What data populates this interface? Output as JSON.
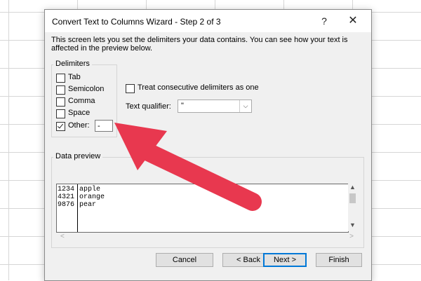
{
  "window": {
    "title": "Convert Text to Columns Wizard - Step 2 of 3",
    "help_label": "?",
    "close_label": "✕"
  },
  "description": "This screen lets you set the delimiters your data contains.  You can see how your text is affected in the preview below.",
  "delimiters": {
    "legend": "Delimiters",
    "items": [
      {
        "label": "Tab",
        "checked": false
      },
      {
        "label": "Semicolon",
        "checked": false
      },
      {
        "label": "Comma",
        "checked": false
      },
      {
        "label": "Space",
        "checked": false
      },
      {
        "label": "Other:",
        "checked": true
      }
    ],
    "other_value": "-"
  },
  "options": {
    "treat_consecutive_label": "Treat consecutive delimiters as one",
    "treat_consecutive_checked": false,
    "text_qualifier_label": "Text qualifier:",
    "text_qualifier_value": "\""
  },
  "preview": {
    "legend": "Data preview",
    "rows": [
      {
        "col1": "1234",
        "col2": "apple"
      },
      {
        "col1": "4321",
        "col2": "orange"
      },
      {
        "col1": "9876",
        "col2": "pear"
      }
    ]
  },
  "buttons": {
    "cancel": "Cancel",
    "back": "< Back",
    "next": "Next >",
    "finish": "Finish"
  },
  "annotation": {
    "arrow_color": "#e8384f"
  }
}
